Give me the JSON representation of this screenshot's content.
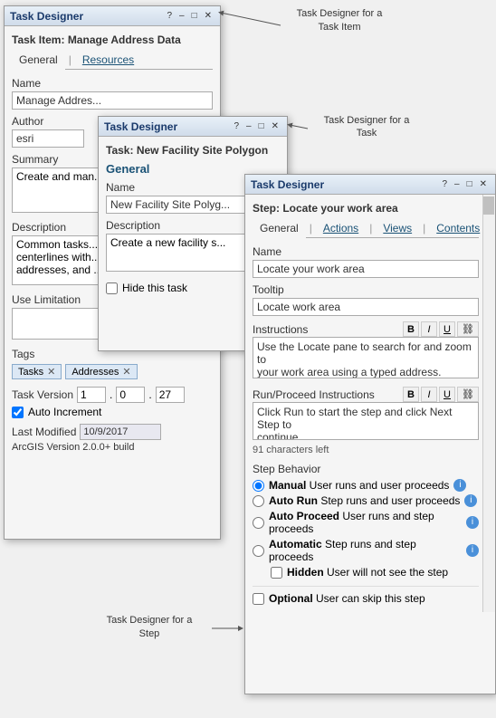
{
  "annotations": {
    "task_item_label": "Task Designer for a\nTask Item",
    "task_label": "Task Designer for a\nTask",
    "step_label": "Task Designer for a\nStep"
  },
  "window1": {
    "title": "Task Designer",
    "task_item": "Task Item:",
    "task_item_name": "Manage Address Data",
    "tabs": [
      "General",
      "Resources"
    ],
    "active_tab": "General",
    "fields": {
      "name_label": "Name",
      "name_value": "Manage Addres...",
      "author_label": "Author",
      "author_value": "esri",
      "summary_label": "Summary",
      "summary_value": "Create and man...",
      "description_label": "Description",
      "description_value": "Common tasks...\ncenterlines with...\naddresses, and ...",
      "use_limitation_label": "Use Limitation",
      "use_limitation_value": "",
      "tags_label": "Tags",
      "tags": [
        "Tasks",
        "Addresses"
      ],
      "version_label": "Task Version",
      "version_parts": [
        "1",
        "0",
        "27"
      ],
      "auto_increment": "Auto Increment",
      "last_modified_label": "Last Modified",
      "last_modified_value": "10/9/2017",
      "arcgis_version": "ArcGIS Version 2.0.0+ build"
    }
  },
  "window2": {
    "title": "Task Designer",
    "task_label": "Task:",
    "task_name": "New Facility Site Polygon",
    "section": "General",
    "tabs": [
      "General"
    ],
    "fields": {
      "name_label": "Name",
      "name_value": "New Facility Site Polyg...",
      "description_label": "Description",
      "description_value": "Create a new facility s...",
      "hide_task_label": "Hide this task"
    }
  },
  "window3": {
    "title": "Task Designer",
    "step_label": "Step:",
    "step_name": "Locate your work area",
    "tabs": [
      "General",
      "Actions",
      "Views",
      "Contents"
    ],
    "active_tab": "General",
    "fields": {
      "name_label": "Name",
      "name_value": "Locate your work area",
      "tooltip_label": "Tooltip",
      "tooltip_value": "Locate work area",
      "instructions_label": "Instructions",
      "instructions_value": "Use the Locate pane to search for and zoom to\nyour work area using a typed address.",
      "run_proceed_label": "Run/Proceed Instructions",
      "run_proceed_value": "Click Run to start the step and click Next Step to\ncontinue",
      "chars_left": "91 characters left",
      "step_behavior_label": "Step Behavior",
      "behaviors": [
        {
          "label": "Manual",
          "desc": "User runs and user proceeds",
          "checked": true
        },
        {
          "label": "Auto Run",
          "desc": "Step runs and user proceeds",
          "checked": false
        },
        {
          "label": "Auto Proceed",
          "desc": "User runs and step proceeds",
          "checked": false
        },
        {
          "label": "Automatic",
          "desc": "Step runs and step proceeds",
          "checked": false
        }
      ],
      "hidden_label": "Hidden",
      "hidden_desc": "User will not see the step",
      "optional_label": "Optional",
      "optional_desc": "User can skip this step"
    },
    "toolbar": {
      "bold": "B",
      "italic": "I",
      "underline": "U",
      "link": "🔗"
    }
  }
}
